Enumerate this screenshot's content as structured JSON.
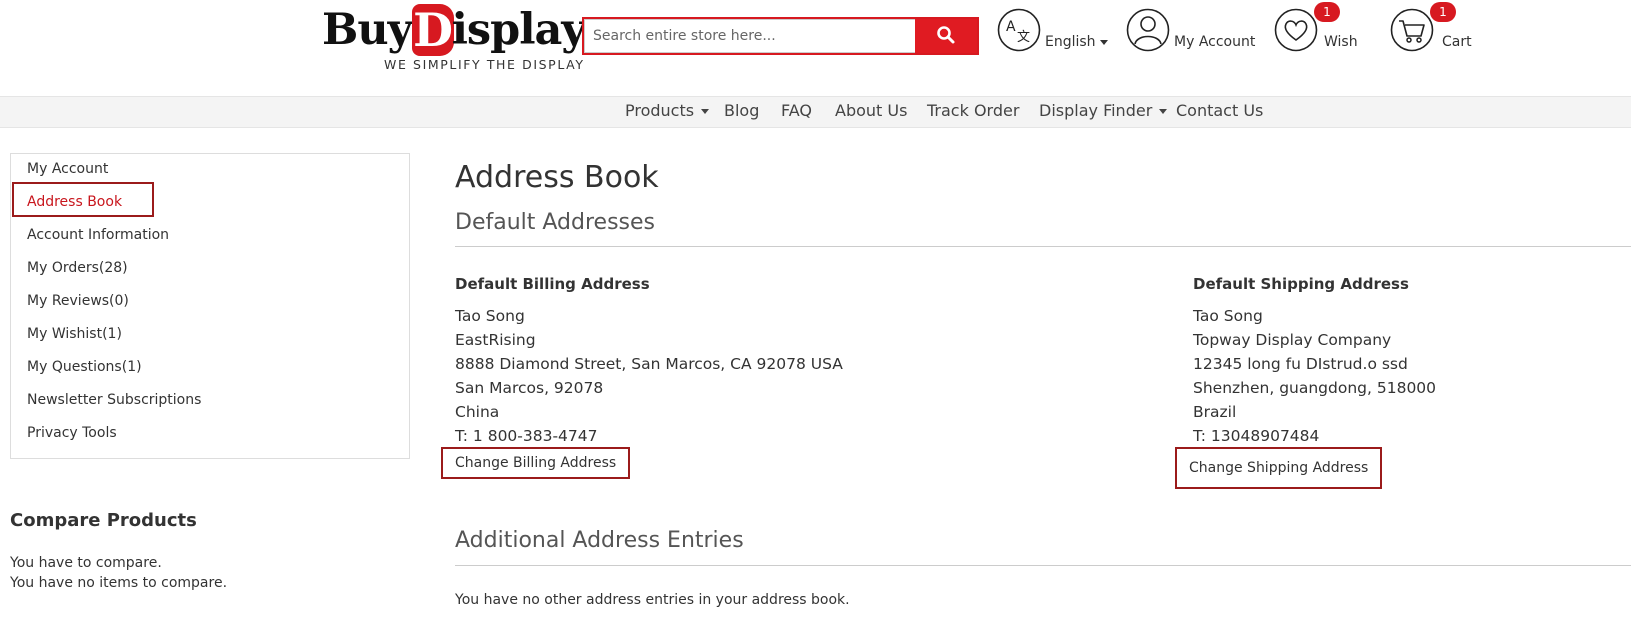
{
  "header": {
    "logo_word": "Buy",
    "logo_letter": "D",
    "logo_rest": "isplay",
    "logo_tagline": "WE SIMPLIFY THE DISPLAY",
    "search_placeholder": "Search entire store here...",
    "language_label": "English",
    "account_label": "My Account",
    "wish_label": "Wish",
    "wish_count": "1",
    "cart_label": "Cart",
    "cart_count": "1"
  },
  "nav": {
    "items": [
      "Products",
      "Blog",
      "FAQ",
      "About Us",
      "Track Order",
      "Display Finder",
      "Contact Us"
    ]
  },
  "sidebar": {
    "items": [
      {
        "label": "My Account"
      },
      {
        "label": "Address Book"
      },
      {
        "label": "Account Information"
      },
      {
        "label": "My Orders(28)"
      },
      {
        "label": "My Reviews(0)"
      },
      {
        "label": "My Wishist(1)"
      },
      {
        "label": "My Questions(1)"
      },
      {
        "label": "Newsletter Subscriptions"
      },
      {
        "label": "Privacy Tools"
      }
    ],
    "active_item": "Address Book"
  },
  "compare": {
    "title": "Compare Products",
    "line1": "You have to compare.",
    "line2": "You have no items to compare."
  },
  "main": {
    "title": "Address Book",
    "default_section": "Default Addresses",
    "billing": {
      "heading": "Default Billing Address",
      "lines": [
        "Tao Song",
        "EastRising",
        "8888 Diamond Street, San Marcos, CA 92078 USA",
        "San Marcos, 92078",
        "China",
        "T: 1 800-383-4747"
      ],
      "button": "Change Billing Address"
    },
    "shipping": {
      "heading": "Default Shipping Address",
      "lines": [
        "Tao Song",
        "Topway Display Company",
        "12345 long fu DIstrud.o ssd",
        "Shenzhen, guangdong, 518000",
        "Brazil",
        "T: 13048907484"
      ],
      "button": "Change Shipping Address"
    },
    "additional_section": "Additional Address Entries",
    "additional_empty": "You have no other address entries in your address book."
  },
  "colors": {
    "brand_red": "#d71920",
    "highlight_border": "#9b1b1b",
    "active_link": "#c8161d"
  }
}
